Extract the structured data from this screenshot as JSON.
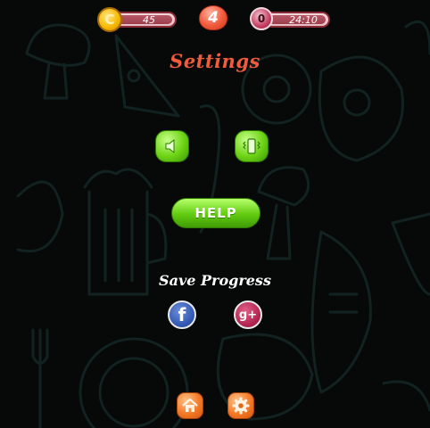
{
  "topbar": {
    "coins": "45",
    "coin_symbol": "C",
    "lives": "4",
    "timer_symbol": "0",
    "timer": "24:10"
  },
  "title": "Settings",
  "buttons": {
    "sound_icon": "speaker-icon",
    "vibrate_icon": "vibrate-icon",
    "help_label": "HELP"
  },
  "save_progress": {
    "label": "Save Progress",
    "facebook_glyph": "f",
    "google_plus_glyph": "g+"
  },
  "bottom": {
    "home_icon": "home-icon",
    "settings_icon": "gear-icon"
  },
  "colors": {
    "background": "#060908",
    "title": "#f05b3d",
    "green_button": "#6ed415",
    "orange_button": "#f47a28"
  }
}
